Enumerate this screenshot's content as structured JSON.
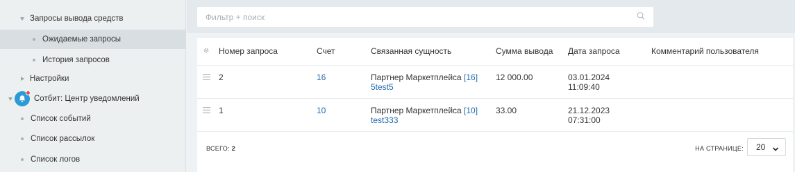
{
  "sidebar": {
    "items": [
      {
        "label": "Запросы вывода средств",
        "icon": "arrow-down-icon"
      },
      {
        "label": "Ожидаемые запросы",
        "icon": "bullet-icon",
        "active": true
      },
      {
        "label": "История запросов",
        "icon": "bullet-icon"
      },
      {
        "label": "Настройки",
        "icon": "arrow-right-icon"
      },
      {
        "label": "Сотбит: Центр уведомлений",
        "icon": "bell-icon"
      },
      {
        "label": "Список событий",
        "icon": "bullet-icon"
      },
      {
        "label": "Список рассылок",
        "icon": "bullet-icon"
      },
      {
        "label": "Список логов",
        "icon": "bullet-icon"
      }
    ]
  },
  "search": {
    "placeholder": "Фильтр + поиск",
    "value": ""
  },
  "table": {
    "headers": [
      "Номер запроса",
      "Счет",
      "Связанная сущность",
      "Сумма вывода",
      "Дата запроса",
      "Комментарий пользователя"
    ],
    "rows": [
      {
        "number": "2",
        "account": "16",
        "entity_text": "Партнер Маркетплейса",
        "entity_id": "[16]",
        "entity_name": "5test5",
        "amount": "12 000.00",
        "date": "03.01.2024",
        "time": "11:09:40",
        "comment": ""
      },
      {
        "number": "1",
        "account": "10",
        "entity_text": "Партнер Маркетплейса",
        "entity_id": "[10]",
        "entity_name": "test333",
        "amount": "33.00",
        "date": "21.12.2023",
        "time": "07:31:00",
        "comment": ""
      }
    ]
  },
  "footer": {
    "total_label": "ВСЕГО:",
    "total_value": "2",
    "per_page_label": "НА СТРАНИЦЕ:",
    "per_page_value": "20"
  },
  "colors": {
    "link": "#2067b0",
    "accent_blue": "#2a9bd6",
    "notification_red": "#e34b4b"
  }
}
